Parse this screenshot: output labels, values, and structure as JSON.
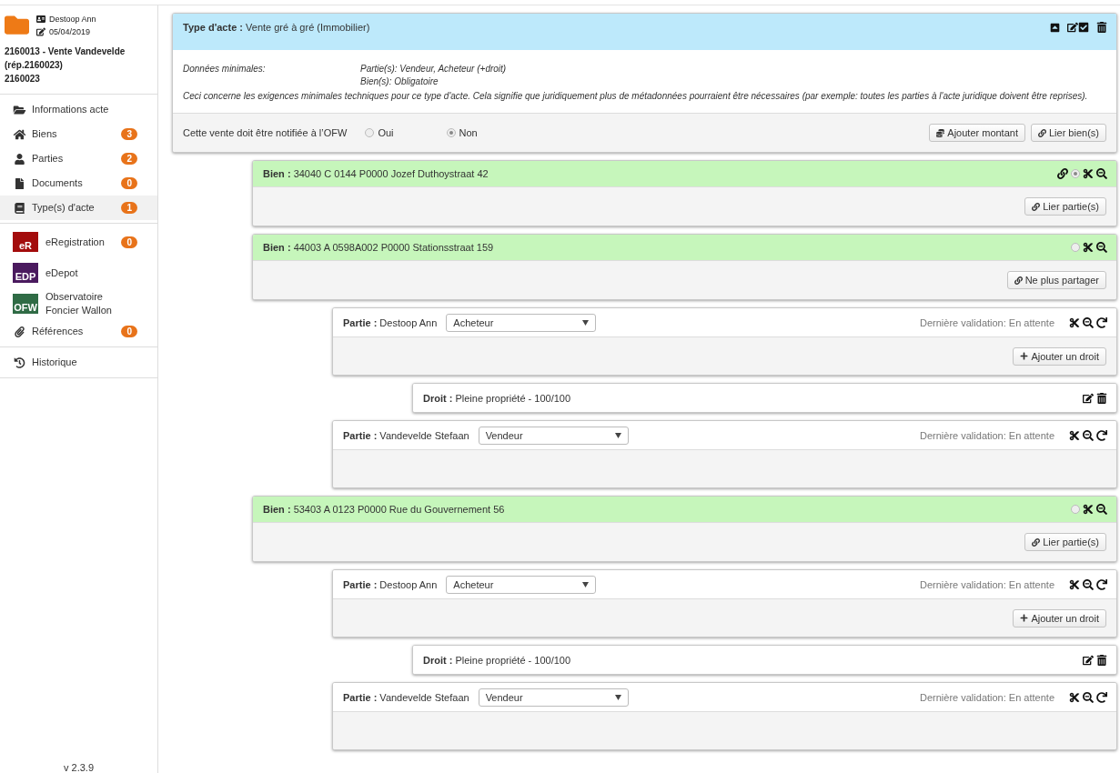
{
  "sidebar": {
    "user": "Destoop Ann",
    "date": "05/04/2019",
    "file_title": "2160013 - Vente Vandevelde (rép.2160023)",
    "file_number": "2160023",
    "groups": [
      {
        "items": [
          {
            "kind": "icon",
            "label": "Informations acte",
            "selected": false
          },
          {
            "kind": "icon",
            "label": "Biens",
            "badge": "3",
            "selected": false
          },
          {
            "kind": "icon",
            "label": "Parties",
            "badge": "2",
            "selected": false
          },
          {
            "kind": "icon",
            "label": "Documents",
            "badge": "0",
            "selected": false
          },
          {
            "kind": "icon",
            "label": "Type(s) d'acte",
            "badge": "1",
            "selected": true
          }
        ]
      },
      {
        "items": [
          {
            "kind": "logo",
            "logo": "eR",
            "color": "#a30c0c",
            "label": "eRegistration",
            "badge": "0",
            "selected": false
          },
          {
            "kind": "logo",
            "logo": "EDP",
            "color": "#4a1a5e",
            "label": "eDepot",
            "selected": false
          },
          {
            "kind": "logo",
            "logo": "OFW",
            "color": "#2f6b45",
            "label": "Observatoire Foncier Wallon",
            "selected": false
          },
          {
            "kind": "icon",
            "label": "Références",
            "badge": "0",
            "selected": false
          }
        ]
      },
      {
        "items": [
          {
            "kind": "icon",
            "label": "Historique",
            "selected": false
          }
        ]
      }
    ],
    "version": "v 2.3.9"
  },
  "type_acte": {
    "label": "Type d'acte :",
    "value": "Vente gré à gré (Immobilier)",
    "minimum_label": "Données minimales:",
    "minimum_values": [
      "Partie(s): Vendeur, Acheteur (+droit)",
      "Bien(s): Obligatoire"
    ],
    "note": "Ceci concerne les exigences minimales techniques pour ce type d'acte. Cela signifie que juridiquement plus de métadonnées pourraient être nécessaires (par exemple: toutes les parties à l'acte juridique doivent être reprises).",
    "ofw_question": "Cette vente doit être notifiée à l’OFW",
    "ofw_options": [
      {
        "label": "Oui",
        "selected": false
      },
      {
        "label": "Non",
        "selected": true
      }
    ],
    "buttons": [
      "Ajouter montant",
      "Lier bien(s)"
    ]
  },
  "biens": [
    {
      "label": "Bien :",
      "value": "34040 C 0144 P0000 Jozef Duthoystraat 42",
      "linked": true,
      "selected": true,
      "button": "Lier partie(s)"
    },
    {
      "label": "Bien :",
      "value": "44003 A 0598A002 P0000 Stationsstraat 159",
      "linked": false,
      "selected": false,
      "button": "Ne plus partager",
      "parties": [
        {
          "label": "Partie :",
          "name": "Destoop Ann",
          "role": "Acheteur",
          "validation": "Dernière validation: En attente",
          "button": "Ajouter un droit",
          "droits": [
            {
              "label": "Droit :",
              "value": "Pleine propriété - 100/100"
            }
          ]
        },
        {
          "label": "Partie :",
          "name": "Vandevelde Stefaan",
          "role": "Vendeur",
          "validation": "Dernière validation: En attente"
        }
      ]
    },
    {
      "label": "Bien :",
      "value": "53403 A 0123 P0000 Rue du Gouvernement 56",
      "linked": false,
      "selected": false,
      "button": "Lier partie(s)",
      "parties": [
        {
          "label": "Partie :",
          "name": "Destoop Ann",
          "role": "Acheteur",
          "validation": "Dernière validation: En attente",
          "button": "Ajouter un droit",
          "droits": [
            {
              "label": "Droit :",
              "value": "Pleine propriété - 100/100"
            }
          ]
        },
        {
          "label": "Partie :",
          "name": "Vandevelde Stefaan",
          "role": "Vendeur",
          "validation": "Dernière validation: En attente"
        }
      ]
    }
  ]
}
